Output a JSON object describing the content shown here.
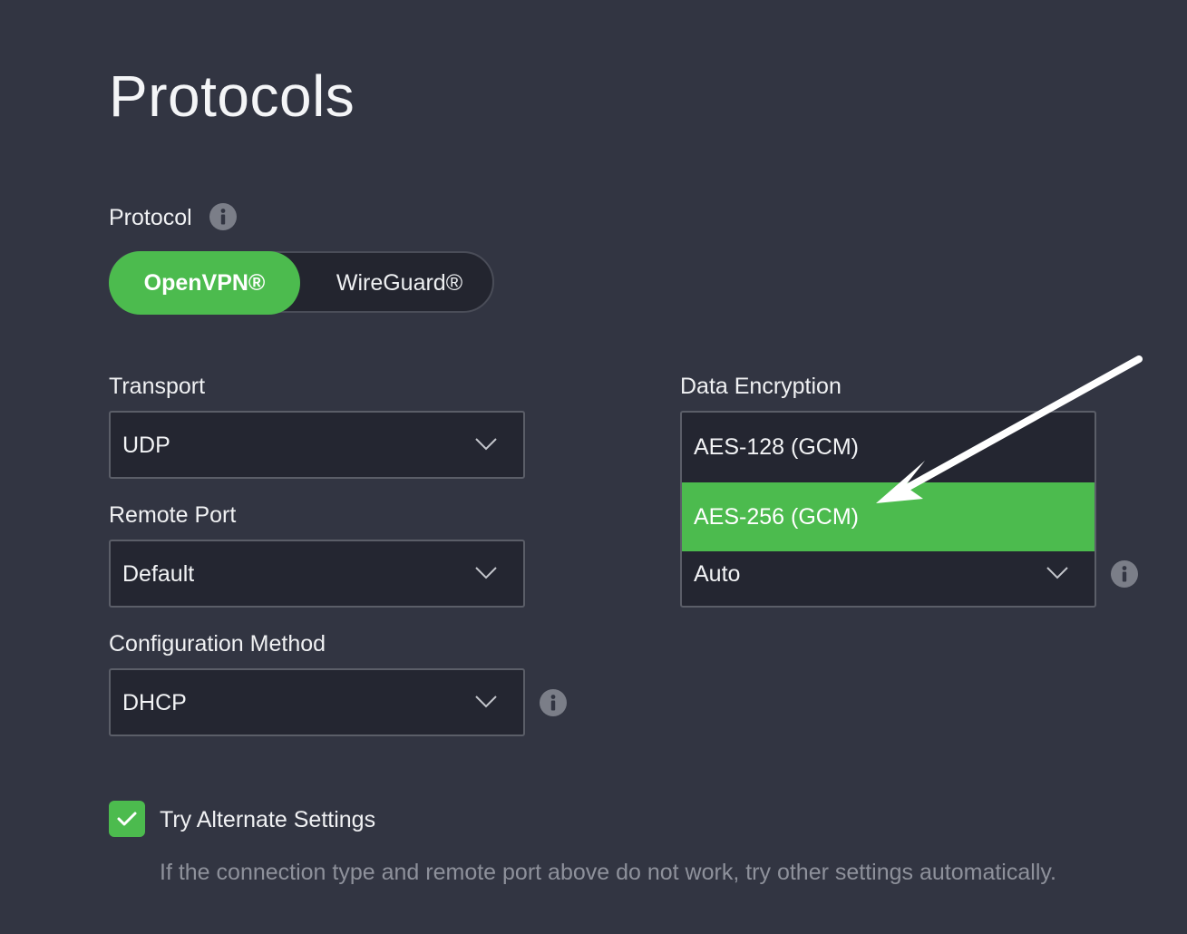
{
  "page": {
    "title": "Protocols"
  },
  "protocol": {
    "label": "Protocol",
    "options": [
      "OpenVPN®",
      "WireGuard®"
    ],
    "selected": "OpenVPN®"
  },
  "transport": {
    "label": "Transport",
    "value": "UDP"
  },
  "remote_port": {
    "label": "Remote Port",
    "value": "Default"
  },
  "configuration_method": {
    "label": "Configuration Method",
    "value": "DHCP"
  },
  "data_encryption": {
    "label": "Data Encryption",
    "value": "Auto",
    "dropdown_open": true,
    "options": [
      "AES-128 (GCM)",
      "AES-256 (GCM)"
    ],
    "highlighted": "AES-256 (GCM)"
  },
  "alternate_settings": {
    "label": "Try Alternate Settings",
    "checked": true,
    "help": "If the connection type and remote port above do not work, try other settings automatically."
  },
  "colors": {
    "background": "#323542",
    "accent_green": "#4cbb4e",
    "field_background": "#242631",
    "muted_text": "#8e919b"
  },
  "icons": {
    "info": "info-icon",
    "chevron": "chevron-down-icon",
    "check": "checkmark-icon",
    "annotation": "arrow-annotation"
  }
}
